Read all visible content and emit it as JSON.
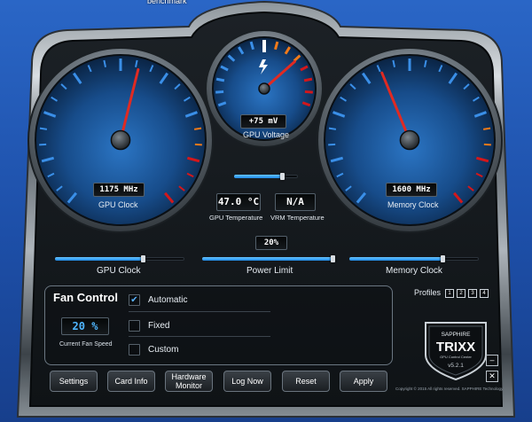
{
  "desktop": {
    "label": "benchmark"
  },
  "gauges": {
    "gpu_clock": {
      "readout": "1175 MHz",
      "label": "GPU Clock",
      "level": 0.55
    },
    "gpu_voltage": {
      "readout": "+75 mV",
      "label": "GPU Voltage",
      "level": 0.72
    },
    "memory_clock": {
      "readout": "1600 MHz",
      "label": "Memory Clock",
      "level": 0.42
    }
  },
  "temps": {
    "gpu": {
      "value": "47.0 °C",
      "label": "GPU Temperature"
    },
    "vrm": {
      "value": "N/A",
      "label": "VRM Temperature"
    }
  },
  "sliders": {
    "voltage": {
      "level": 0.75
    },
    "power_limit": {
      "readout": "20%",
      "label": "Power Limit",
      "level": 0.98
    },
    "gpu_clock": {
      "label": "GPU Clock",
      "level": 0.68
    },
    "memory_clock": {
      "label": "Memory Clock",
      "level": 0.72
    }
  },
  "fan_control": {
    "title": "Fan Control",
    "speed": "20 %",
    "speed_label": "Current Fan Speed",
    "options": [
      {
        "label": "Automatic",
        "checked": true
      },
      {
        "label": "Fixed",
        "checked": false
      },
      {
        "label": "Custom",
        "checked": false
      }
    ]
  },
  "profiles": {
    "label": "Profiles",
    "slots": [
      "1",
      "2",
      "3",
      "4"
    ]
  },
  "logo": {
    "brand": "SAPPHIRE",
    "product": "TRIXX",
    "subtitle": "GPU Control Center",
    "version": "v5.2.1"
  },
  "buttons": {
    "settings": "Settings",
    "card_info": "Card Info",
    "hardware_monitor": "Hardware Monitor",
    "log_now": "Log Now",
    "reset": "Reset",
    "apply": "Apply"
  },
  "copyright": "Copyright © 2015 All rights reserved. SAPPHIRE Technology",
  "window": {
    "minimize": "–",
    "close": "✕"
  },
  "colors": {
    "accent_blue": "#3a8fe8",
    "needle_red": "#e02a22",
    "warn_orange": "#f07a1a",
    "danger_red": "#d4171b"
  }
}
